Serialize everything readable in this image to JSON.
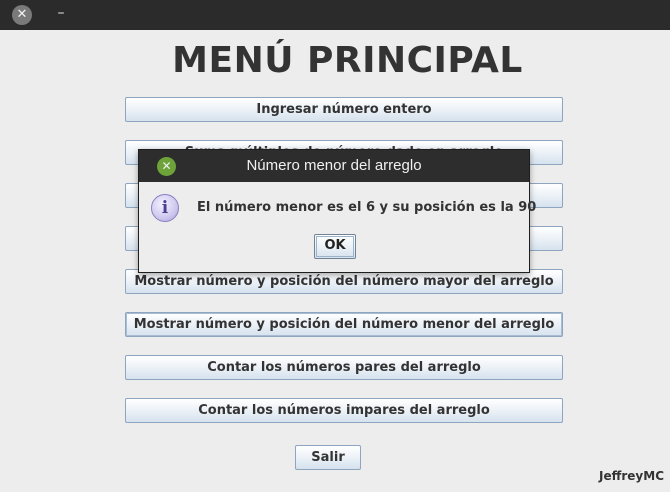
{
  "window": {
    "close_glyph": "✕",
    "minimize_glyph": "–"
  },
  "main": {
    "title": "MENÚ PRINCIPAL",
    "buttons": [
      "Ingresar número entero",
      "Suma múltiplos de número dado en arreglo",
      "",
      "",
      "Mostrar número y posición del número mayor del arreglo",
      "Mostrar número y posición del número menor del arreglo",
      "Contar los números pares del arreglo",
      "Contar los números impares del arreglo"
    ],
    "exit_label": "Salir",
    "credit": "JeffreyMC"
  },
  "dialog": {
    "title": "Número menor del arreglo",
    "close_glyph": "✕",
    "icon": "info-icon",
    "icon_glyph": "i",
    "message": "El número menor es el 6 y su posición es la 90",
    "ok_label": "OK"
  }
}
